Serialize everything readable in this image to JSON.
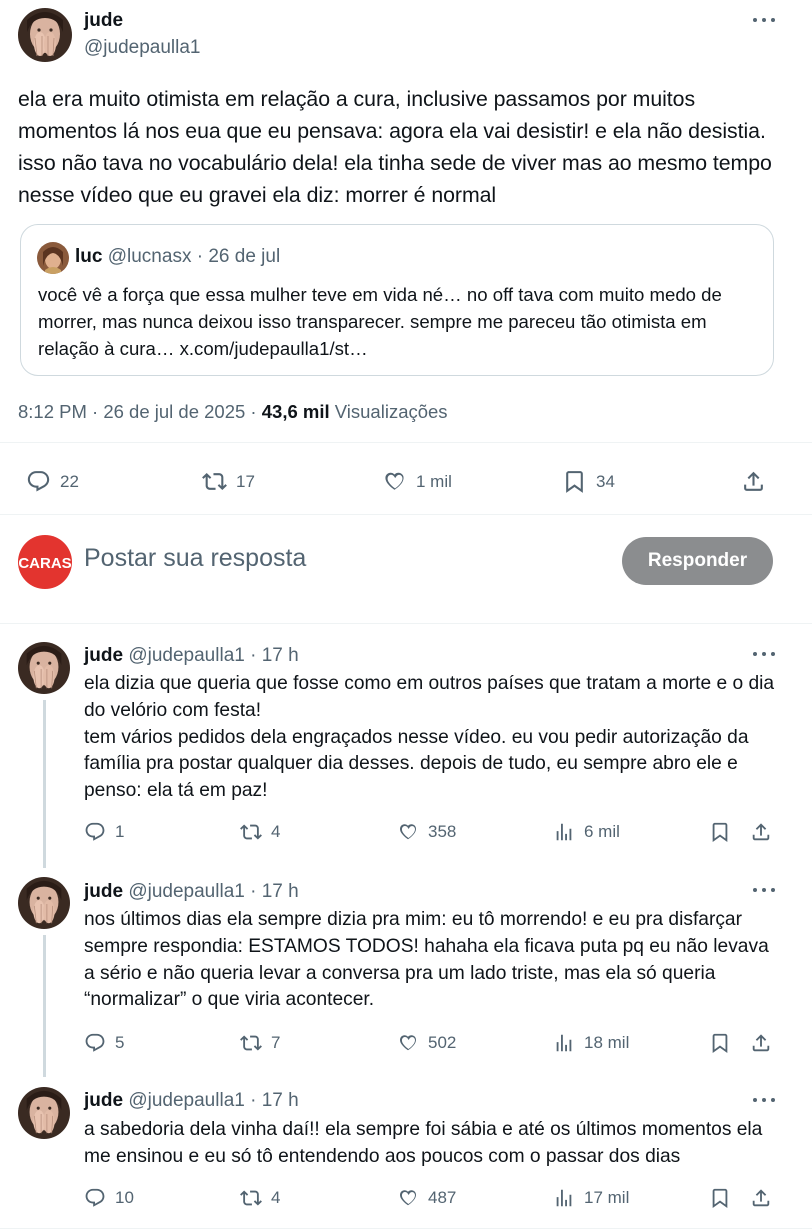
{
  "main_tweet": {
    "name": "jude",
    "handle": "@judepaulla1",
    "text": "ela era muito otimista em relação a cura, inclusive passamos por muitos momentos lá nos eua que eu pensava: agora ela vai desistir! e ela não desistia. isso não tava no vocabulário dela! ela tinha sede de viver mas ao mesmo tempo nesse vídeo que eu gravei ela diz: morrer é normal",
    "quote": {
      "name": "luc",
      "handle": "@lucnasx",
      "date": "· 26 de jul",
      "text": "você vê a força que essa mulher teve em vida né… no off tava com muito medo de morrer, mas nunca deixou isso transparecer. sempre me pareceu tão otimista em relação à cura… x.com/judepaulla1/st…"
    },
    "timestamp": "8:12 PM · 26 de jul de 2025 ·",
    "views_count": "43,6 mil",
    "views_label": "Visualizações",
    "actions": {
      "replies": "22",
      "reposts": "17",
      "likes": "1 mil",
      "bookmarks": "34"
    }
  },
  "composer": {
    "avatar_text": "CARAS",
    "placeholder": "Postar sua resposta",
    "button_label": "Responder"
  },
  "replies": [
    {
      "name": "jude",
      "handle": "@judepaulla1",
      "time": "· 17 h",
      "text": "ela dizia que queria que fosse como em outros países que tratam a morte e o dia do velório com festa!\ntem vários pedidos dela engraçados nesse vídeo. eu vou pedir autorização da família pra postar qualquer dia desses. depois de tudo, eu sempre abro ele e penso: ela tá em paz!",
      "replies": "1",
      "reposts": "4",
      "likes": "358",
      "views": "6 mil"
    },
    {
      "name": "jude",
      "handle": "@judepaulla1",
      "time": "· 17 h",
      "text": "nos últimos dias ela sempre dizia pra mim: eu tô morrendo! e eu pra disfarçar sempre respondia: ESTAMOS TODOS! hahaha ela ficava puta pq eu não levava a sério e não queria levar a conversa pra um lado triste, mas ela só queria “normalizar” o que viria acontecer.",
      "replies": "5",
      "reposts": "7",
      "likes": "502",
      "views": "18 mil"
    },
    {
      "name": "jude",
      "handle": "@judepaulla1",
      "time": "· 17 h",
      "text": "a sabedoria dela vinha daí!! ela sempre foi sábia e até os últimos momentos ela me ensinou e eu só tô entendendo aos poucos com o passar dos dias",
      "replies": "10",
      "reposts": "4",
      "likes": "487",
      "views": "17 mil"
    }
  ],
  "colors": {
    "text": "#0f1419",
    "muted": "#536471",
    "border": "#cfd9de",
    "caras_red": "#e3342f",
    "button_grey": "#8b8d8f"
  },
  "icons": [
    "reply-icon",
    "repost-icon",
    "like-icon",
    "bookmark-icon",
    "share-icon",
    "views-icon",
    "more-icon"
  ]
}
